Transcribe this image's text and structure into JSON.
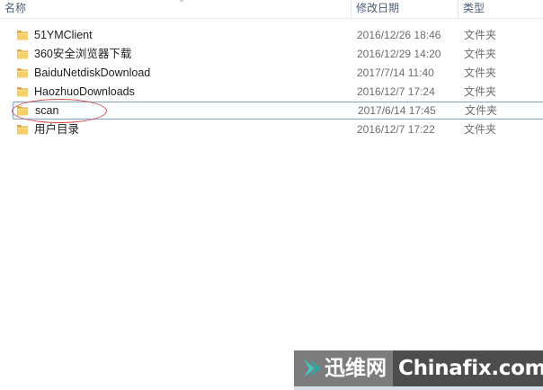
{
  "columns": {
    "name": "名称",
    "modified": "修改日期",
    "type": "类型"
  },
  "rows": [
    {
      "name": "51YMClient",
      "modified": "2016/12/26 18:46",
      "type": "文件夹",
      "icon": "folder-icon"
    },
    {
      "name": "360安全浏览器下载",
      "modified": "2016/12/29 14:20",
      "type": "文件夹",
      "icon": "folder-icon"
    },
    {
      "name": "BaiduNetdiskDownload",
      "modified": "2017/7/14 11:40",
      "type": "文件夹",
      "icon": "folder-icon"
    },
    {
      "name": "HaozhuoDownloads",
      "modified": "2016/12/7 17:24",
      "type": "文件夹",
      "icon": "folder-icon"
    },
    {
      "name": "scan",
      "modified": "2017/6/14 17:45",
      "type": "文件夹",
      "icon": "folder-icon",
      "focused": true
    },
    {
      "name": "用户目录",
      "modified": "2016/12/7 17:22",
      "type": "文件夹",
      "icon": "folder-icon"
    }
  ],
  "watermark": {
    "cn_text": "迅维网",
    "en_text": "Chinafix.com"
  },
  "colors": {
    "header_text": "#4c607a",
    "focus_border": "#7da2ce",
    "annotation_ellipse": "#d94a4a",
    "folder": "#e9b94c"
  }
}
